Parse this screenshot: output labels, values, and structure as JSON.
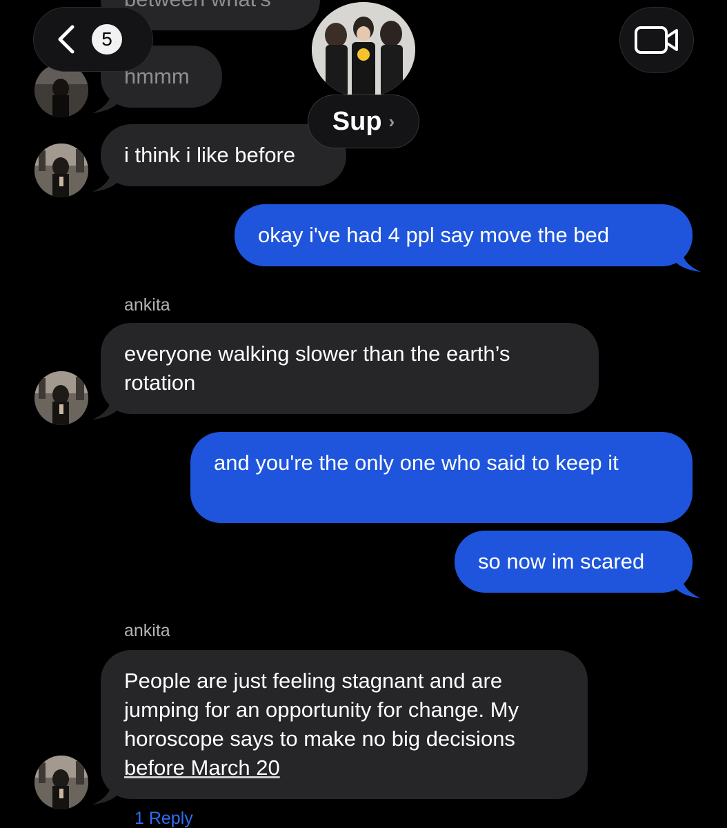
{
  "header": {
    "back_count": "5",
    "group_name": "Sup",
    "group_chevron": "›"
  },
  "messages": [
    {
      "id": "m0",
      "direction": "incoming",
      "text": "between what's"
    },
    {
      "id": "m1",
      "direction": "incoming",
      "text": "hmmm"
    },
    {
      "id": "m2",
      "direction": "incoming",
      "text": "i think i like before"
    },
    {
      "id": "m3",
      "direction": "outgoing",
      "text": "okay i've had 4 ppl say move the bed"
    },
    {
      "id": "m4",
      "direction": "incoming",
      "sender": "ankita",
      "text": "everyone walking slower than the earth’s rotation"
    },
    {
      "id": "m5",
      "direction": "outgoing",
      "text": "and you're the only one who said to keep it"
    },
    {
      "id": "m6",
      "direction": "outgoing",
      "text": "so now im scared"
    },
    {
      "id": "m7",
      "direction": "incoming",
      "sender": "ankita",
      "text": "People are just feeling stagnant and are jumping for an opportunity for change. My horoscope says to make no big decisions ",
      "link_text": "before March 20"
    }
  ],
  "reply_label": "1 Reply",
  "colors": {
    "background": "#000000",
    "incoming_bubble": "#262628",
    "outgoing_bubble": "#1e55dc",
    "reply_link": "#2f6ef0"
  },
  "icons": {
    "back": "chevron-left-icon",
    "video": "video-camera-icon"
  }
}
